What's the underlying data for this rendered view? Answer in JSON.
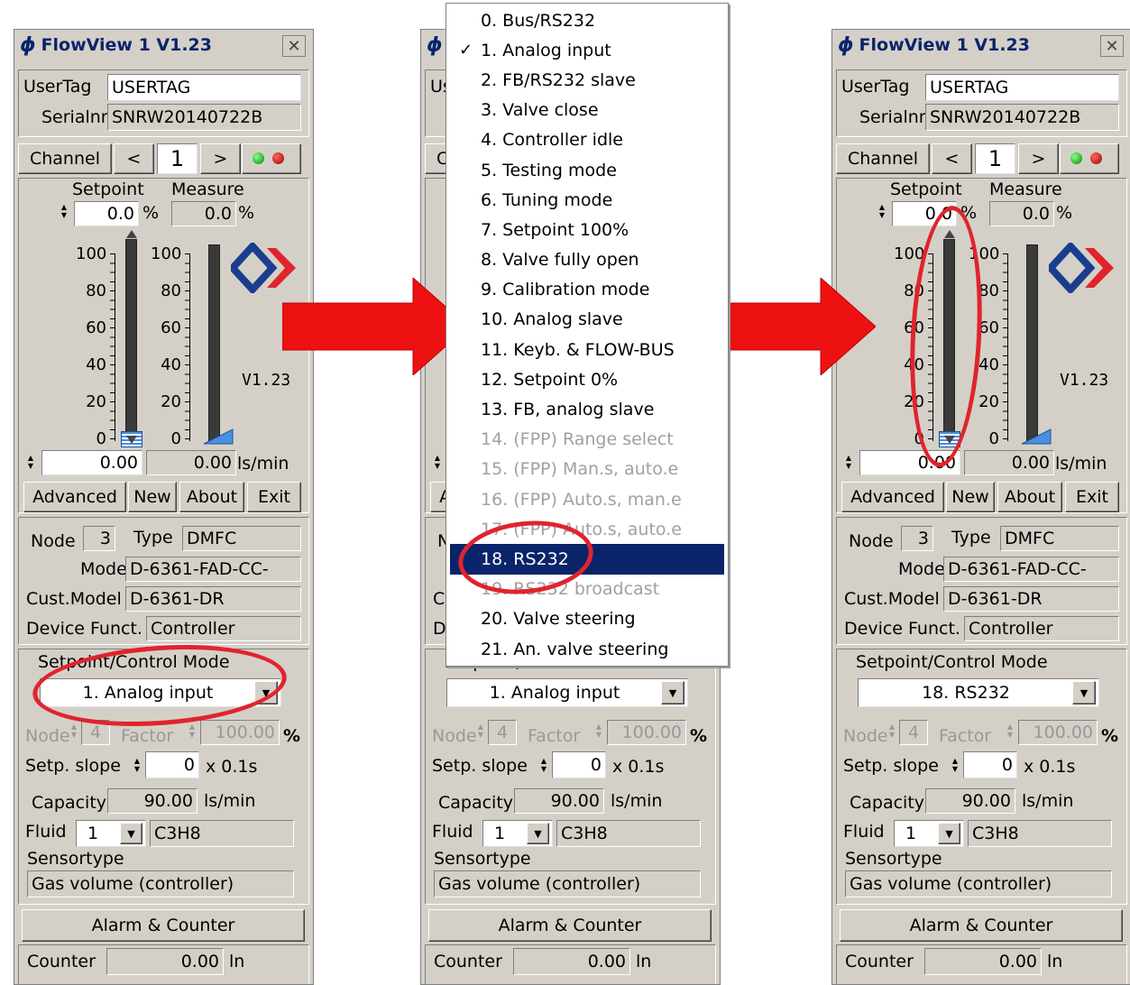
{
  "colors": {
    "accent": "#e0242c",
    "titletext": "#0a246a",
    "selection": "#0a246a",
    "arrow": "#ee1111"
  },
  "panels": [
    {
      "title": "FlowView 1 V1.23",
      "usertag_label": "UserTag",
      "usertag": "USERTAG",
      "serial_label": "Serialnr",
      "serial": "SNRW20140722B",
      "channel_label": "Channel",
      "prev": "<",
      "channel": "1",
      "next": ">",
      "setpoint_label": "Setpoint",
      "measure_label": "Measure",
      "setpoint_value": "0.0",
      "pct": "%",
      "measure_value": "0.0",
      "version": "V1.23",
      "flow_setpoint": "0.00",
      "flow_measure": "0.00",
      "unit": "ls/min",
      "advanced": "Advanced",
      "new": "New",
      "about": "About",
      "exit": "Exit",
      "node_label": "Node",
      "node": "3",
      "type_label": "Type",
      "type": "DMFC",
      "model_label": "Model",
      "model": "D-6361-FAD-CC-",
      "custmodel_label": "Cust.Model",
      "custmodel": "D-6361-DR",
      "devfunct_label": "Device Funct.",
      "devfunct": "Controller",
      "mode_label": "Setpoint/Control Mode",
      "mode": "1. Analog input",
      "node2_label": "Node",
      "node2": "4",
      "factor_label": "Factor",
      "factor": "100.00",
      "slope_label": "Setp. slope",
      "slope": "0",
      "slope_unit": "x 0.1s",
      "capacity_label": "Capacity",
      "capacity": "90.00",
      "fluid_label": "Fluid",
      "fluid_num": "1",
      "fluid": "C3H8",
      "sensortype_label": "Sensortype",
      "sensortype": "Gas volume (controller)",
      "alarm": "Alarm & Counter",
      "counter_label": "Counter",
      "counter": "0.00",
      "counter_unit": "ln"
    },
    {
      "title": "FlowView 1 V1.23",
      "usertag_label": "UserTag",
      "usertag": "USERTAG",
      "serial_label": "Serialnr",
      "serial": "SNRW20140722B",
      "channel_label": "Channel",
      "prev": "<",
      "channel": "1",
      "next": ">",
      "setpoint_label": "Setpoint",
      "measure_label": "Measure",
      "setpoint_value": "0.0",
      "pct": "%",
      "measure_value": "0.0",
      "version": "V1.23",
      "flow_setpoint": "0.00",
      "flow_measure": "0.00",
      "unit": "ls/min",
      "advanced": "Advanced",
      "new": "New",
      "about": "About",
      "exit": "Exit",
      "node_label": "Node",
      "node": "3",
      "type_label": "Type",
      "type": "DMFC",
      "model_label": "Model",
      "model": "D-6361-FAD-CC-",
      "custmodel_label": "Cust.Model",
      "custmodel": "D-6361-DR",
      "devfunct_label": "Device Funct.",
      "devfunct": "Controller",
      "mode_label": "Setpoint/Control Mode",
      "mode": "1. Analog input",
      "node2_label": "Node",
      "node2": "4",
      "factor_label": "Factor",
      "factor": "100.00",
      "slope_label": "Setp. slope",
      "slope": "0",
      "slope_unit": "x 0.1s",
      "capacity_label": "Capacity",
      "capacity": "90.00",
      "fluid_label": "Fluid",
      "fluid_num": "1",
      "fluid": "C3H8",
      "sensortype_label": "Sensortype",
      "sensortype": "Gas volume (controller)",
      "alarm": "Alarm & Counter",
      "counter_label": "Counter",
      "counter": "0.00",
      "counter_unit": "ln"
    },
    {
      "title": "FlowView 1 V1.23",
      "usertag_label": "UserTag",
      "usertag": "USERTAG",
      "serial_label": "Serialnr",
      "serial": "SNRW20140722B",
      "channel_label": "Channel",
      "prev": "<",
      "channel": "1",
      "next": ">",
      "setpoint_label": "Setpoint",
      "measure_label": "Measure",
      "setpoint_value": "0.0",
      "pct": "%",
      "measure_value": "0.0",
      "version": "V1.23",
      "flow_setpoint": "0.00",
      "flow_measure": "0.00",
      "unit": "ls/min",
      "advanced": "Advanced",
      "new": "New",
      "about": "About",
      "exit": "Exit",
      "node_label": "Node",
      "node": "3",
      "type_label": "Type",
      "type": "DMFC",
      "model_label": "Model",
      "model": "D-6361-FAD-CC-",
      "custmodel_label": "Cust.Model",
      "custmodel": "D-6361-DR",
      "devfunct_label": "Device Funct.",
      "devfunct": "Controller",
      "mode_label": "Setpoint/Control Mode",
      "mode": "18. RS232",
      "node2_label": "Node",
      "node2": "4",
      "factor_label": "Factor",
      "factor": "100.00",
      "slope_label": "Setp. slope",
      "slope": "0",
      "slope_unit": "x 0.1s",
      "capacity_label": "Capacity",
      "capacity": "90.00",
      "fluid_label": "Fluid",
      "fluid_num": "1",
      "fluid": "C3H8",
      "sensortype_label": "Sensortype",
      "sensortype": "Gas volume (controller)",
      "alarm": "Alarm & Counter",
      "counter_label": "Counter",
      "counter": "0.00",
      "counter_unit": "ln"
    }
  ],
  "scale_ticks": [
    "100",
    "80",
    "60",
    "40",
    "20",
    "0"
  ],
  "setpoint_level": 0,
  "measure_level": 0,
  "menu": {
    "items": [
      {
        "label": "0. Bus/RS232",
        "state": "normal"
      },
      {
        "label": "1. Analog input",
        "state": "checked"
      },
      {
        "label": "2. FB/RS232 slave",
        "state": "normal"
      },
      {
        "label": "3. Valve close",
        "state": "normal"
      },
      {
        "label": "4. Controller idle",
        "state": "normal"
      },
      {
        "label": "5. Testing mode",
        "state": "normal"
      },
      {
        "label": "6. Tuning mode",
        "state": "normal"
      },
      {
        "label": "7. Setpoint 100%",
        "state": "normal"
      },
      {
        "label": "8. Valve fully open",
        "state": "normal"
      },
      {
        "label": "9. Calibration mode",
        "state": "normal"
      },
      {
        "label": "10. Analog slave",
        "state": "normal"
      },
      {
        "label": "11. Keyb. & FLOW-BUS",
        "state": "normal"
      },
      {
        "label": "12. Setpoint 0%",
        "state": "normal"
      },
      {
        "label": "13. FB, analog slave",
        "state": "normal"
      },
      {
        "label": "14. (FPP) Range select",
        "state": "disabled"
      },
      {
        "label": "15. (FPP) Man.s, auto.e",
        "state": "disabled"
      },
      {
        "label": "16. (FPP) Auto.s, man.e",
        "state": "disabled"
      },
      {
        "label": "17. (FPP) Auto.s, auto.e",
        "state": "disabled"
      },
      {
        "label": "18. RS232",
        "state": "selected"
      },
      {
        "label": "19. RS232 broadcast",
        "state": "disabled"
      },
      {
        "label": "20. Valve steering",
        "state": "normal"
      },
      {
        "label": "21. An. valve steering",
        "state": "normal"
      }
    ],
    "check_glyph": "✓"
  }
}
